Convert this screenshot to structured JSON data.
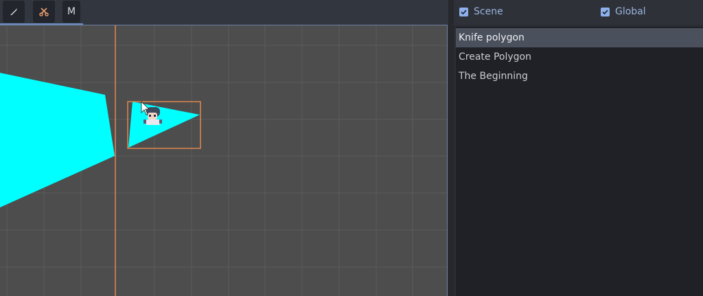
{
  "toolbar": {
    "tools": [
      {
        "name": "knife-tool",
        "icon": "knife-icon"
      },
      {
        "name": "scissors-tool",
        "icon": "scissors-icon"
      },
      {
        "name": "m-tool",
        "label": "M"
      }
    ]
  },
  "viewport": {
    "grid_color": "#5a5a5a",
    "background": "#4d4d4d",
    "shape_color": "#00ffff",
    "guide_color": "#e08850"
  },
  "panel": {
    "scene_label": "Scene",
    "global_label": "Global",
    "scene_checked": true,
    "global_checked": true,
    "items": [
      {
        "label": "Knife polygon",
        "selected": true
      },
      {
        "label": "Create Polygon",
        "selected": false
      },
      {
        "label": "The Beginning",
        "selected": false
      }
    ]
  }
}
